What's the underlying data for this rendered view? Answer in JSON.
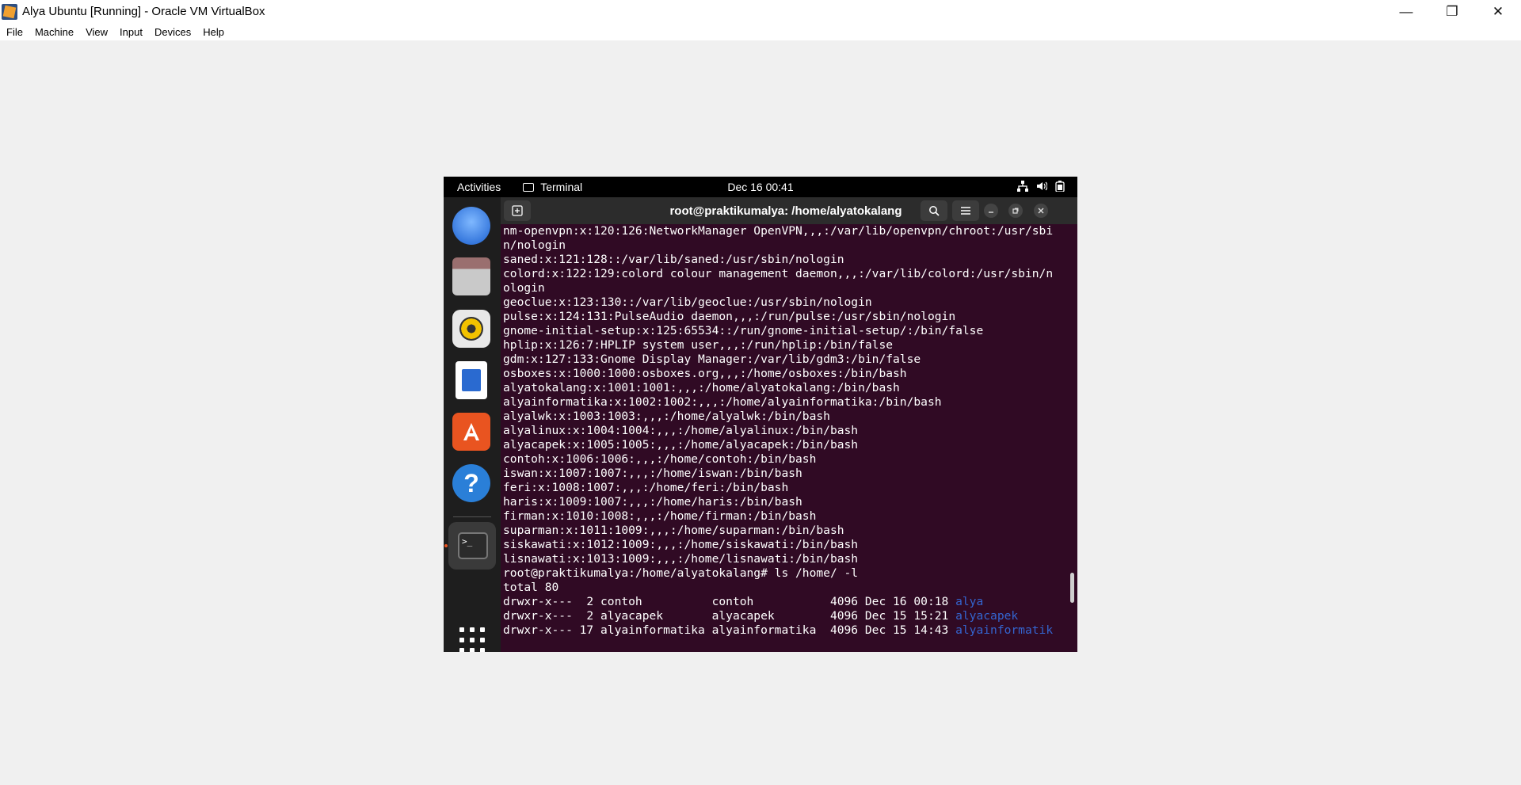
{
  "window": {
    "title": "Alya Ubuntu [Running] - Oracle VM VirtualBox",
    "minimize": "—",
    "maximize": "❐",
    "close": "✕"
  },
  "menubar": [
    "File",
    "Machine",
    "View",
    "Input",
    "Devices",
    "Help"
  ],
  "topbar": {
    "activities": "Activities",
    "app": "Terminal",
    "clock": "Dec 16  00:41",
    "icons": [
      "network-icon",
      "volume-icon",
      "battery-icon"
    ]
  },
  "dock": {
    "items": [
      "thunderbird-icon",
      "files-icon",
      "rhythmbox-icon",
      "libreoffice-writer-icon",
      "software-store-icon",
      "help-icon",
      "terminal-icon",
      "show-apps-icon"
    ],
    "help_glyph": "?",
    "terminal_glyph": ">_"
  },
  "terminal": {
    "title": "root@praktikumalya: /home/alyatokalang",
    "lines": [
      "nm-openvpn:x:120:126:NetworkManager OpenVPN,,,:/var/lib/openvpn/chroot:/usr/sbi",
      "n/nologin",
      "saned:x:121:128::/var/lib/saned:/usr/sbin/nologin",
      "colord:x:122:129:colord colour management daemon,,,:/var/lib/colord:/usr/sbin/n",
      "ologin",
      "geoclue:x:123:130::/var/lib/geoclue:/usr/sbin/nologin",
      "pulse:x:124:131:PulseAudio daemon,,,:/run/pulse:/usr/sbin/nologin",
      "gnome-initial-setup:x:125:65534::/run/gnome-initial-setup/:/bin/false",
      "hplip:x:126:7:HPLIP system user,,,:/run/hplip:/bin/false",
      "gdm:x:127:133:Gnome Display Manager:/var/lib/gdm3:/bin/false",
      "osboxes:x:1000:1000:osboxes.org,,,:/home/osboxes:/bin/bash",
      "alyatokalang:x:1001:1001:,,,:/home/alyatokalang:/bin/bash",
      "alyainformatika:x:1002:1002:,,,:/home/alyainformatika:/bin/bash",
      "alyalwk:x:1003:1003:,,,:/home/alyalwk:/bin/bash",
      "alyalinux:x:1004:1004:,,,:/home/alyalinux:/bin/bash",
      "alyacapek:x:1005:1005:,,,:/home/alyacapek:/bin/bash",
      "contoh:x:1006:1006:,,,:/home/contoh:/bin/bash",
      "iswan:x:1007:1007:,,,:/home/iswan:/bin/bash",
      "feri:x:1008:1007:,,,:/home/feri:/bin/bash",
      "haris:x:1009:1007:,,,:/home/haris:/bin/bash",
      "firman:x:1010:1008:,,,:/home/firman:/bin/bash",
      "suparman:x:1011:1009:,,,:/home/suparman:/bin/bash",
      "siskawati:x:1012:1009:,,,:/home/siskawati:/bin/bash",
      "lisnawati:x:1013:1009:,,,:/home/lisnawati:/bin/bash",
      "root@praktikumalya:/home/alyatokalang# ls /home/ -l",
      "total 80"
    ],
    "listing": [
      {
        "perm": "drwxr-x---  2 contoh          contoh           4096 Dec 16 00:18 ",
        "name": "alya"
      },
      {
        "perm": "drwxr-x---  2 alyacapek       alyacapek        4096 Dec 15 15:21 ",
        "name": "alyacapek"
      },
      {
        "perm": "drwxr-x--- 17 alyainformatika alyainformatika  4096 Dec 15 14:43 ",
        "name": "alyainformatik"
      }
    ],
    "colors": {
      "background": "#300a24",
      "directory": "#3465d0"
    }
  }
}
